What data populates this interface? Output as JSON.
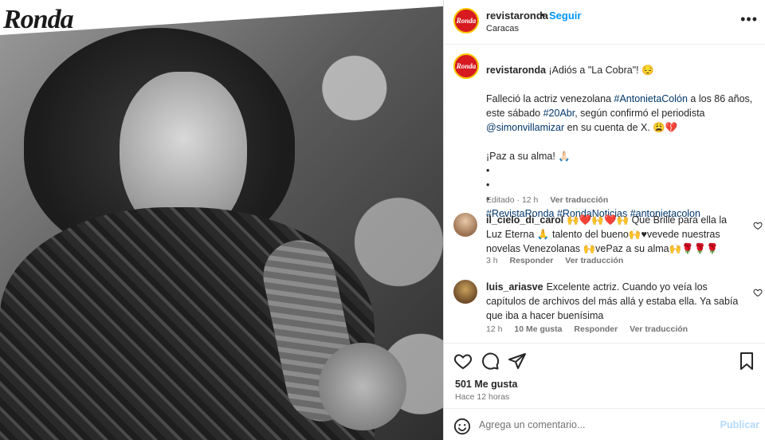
{
  "brand": {
    "logo_text": "Ronda"
  },
  "post": {
    "username": "revistaronda",
    "follow_label": "Seguir",
    "location": "Caracas",
    "more_label": "•••"
  },
  "caption": {
    "username": "revistaronda",
    "line1": "¡Adiós a \"La Cobra\"! 😔",
    "p2_a": "Falleció la actriz venezolana ",
    "p2_tag1": "#AntonietaColón",
    "p2_b": " a los 86 años, este sábado ",
    "p2_tag2": "#20Abr",
    "p2_c": ", según confirmó el periodista ",
    "p2_mention": "@simonvillamizar",
    "p2_d": " en su cuenta de X. 😩💔",
    "p3": "¡Paz a su alma! 🙏🏻",
    "bullet": "•",
    "tags": [
      "#RevistaRonda",
      "#RondaNoticias",
      "#antonietacolon"
    ],
    "edited": "Editado · 12 h",
    "translate": "Ver traducción"
  },
  "comments": [
    {
      "username": "il_cielo_di_carol",
      "text": "🙌❤️🙌❤️🙌 Que Brille para ella la Luz Eterna 🙏 talento del bueno🙌♥vevede nuestras novelas Venezolanas 🙌vePaz a su alma🙌🌹🌹🌹",
      "time": "3 h",
      "reply": "Responder",
      "translate": "Ver traducción"
    },
    {
      "username": "luis_ariasve",
      "text": "Excelente actriz. Cuando yo veía los capítulos de archivos del más allá y estaba ella. Ya sabía que iba a hacer buenísima",
      "time": "12 h",
      "likes": "10 Me gusta",
      "reply": "Responder",
      "translate": "Ver traducción"
    }
  ],
  "actions": {
    "likes": "501 Me gusta",
    "time_ago": "Hace 12 horas"
  },
  "comment_input": {
    "placeholder": "Agrega un comentario...",
    "publish": "Publicar"
  },
  "colors": {
    "accent": "#0095f6",
    "link": "#00376b",
    "muted": "#737373",
    "brand_red": "#d71920",
    "brand_yellow": "#f6c700"
  }
}
